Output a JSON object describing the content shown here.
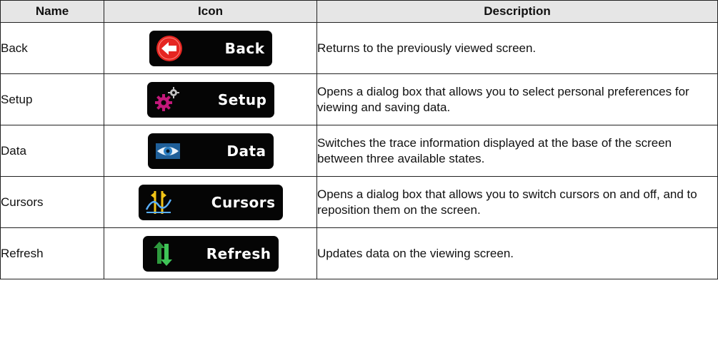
{
  "header": {
    "name": "Name",
    "icon": "Icon",
    "description": "Description"
  },
  "rows": [
    {
      "name": "Back",
      "button_label": "Back",
      "icon_name": "back-arrow-icon",
      "description": "Returns to the previously viewed screen."
    },
    {
      "name": "Setup",
      "button_label": "Setup",
      "icon_name": "gears-icon",
      "description": "Opens a dialog box that allows you to select personal preferences for viewing and saving data."
    },
    {
      "name": "Data",
      "button_label": "Data",
      "icon_name": "eye-icon",
      "description": "Switches the trace information displayed at the base of the screen between three available states."
    },
    {
      "name": "Cursors",
      "button_label": "Cursors",
      "icon_name": "cursors-icon",
      "description": "Opens a dialog box that allows you to switch cursors on and off, and to reposition them on the screen."
    },
    {
      "name": "Refresh",
      "button_label": "Refresh",
      "icon_name": "refresh-arrows-icon",
      "description": "Updates data on the viewing screen."
    }
  ],
  "colors": {
    "button_bg": "#050505",
    "back_red": "#e52521",
    "setup_magenta": "#c2187a",
    "data_blue": "#2a7fc4",
    "cursor_yellow": "#f2c416",
    "refresh_green": "#2e9a3e"
  }
}
